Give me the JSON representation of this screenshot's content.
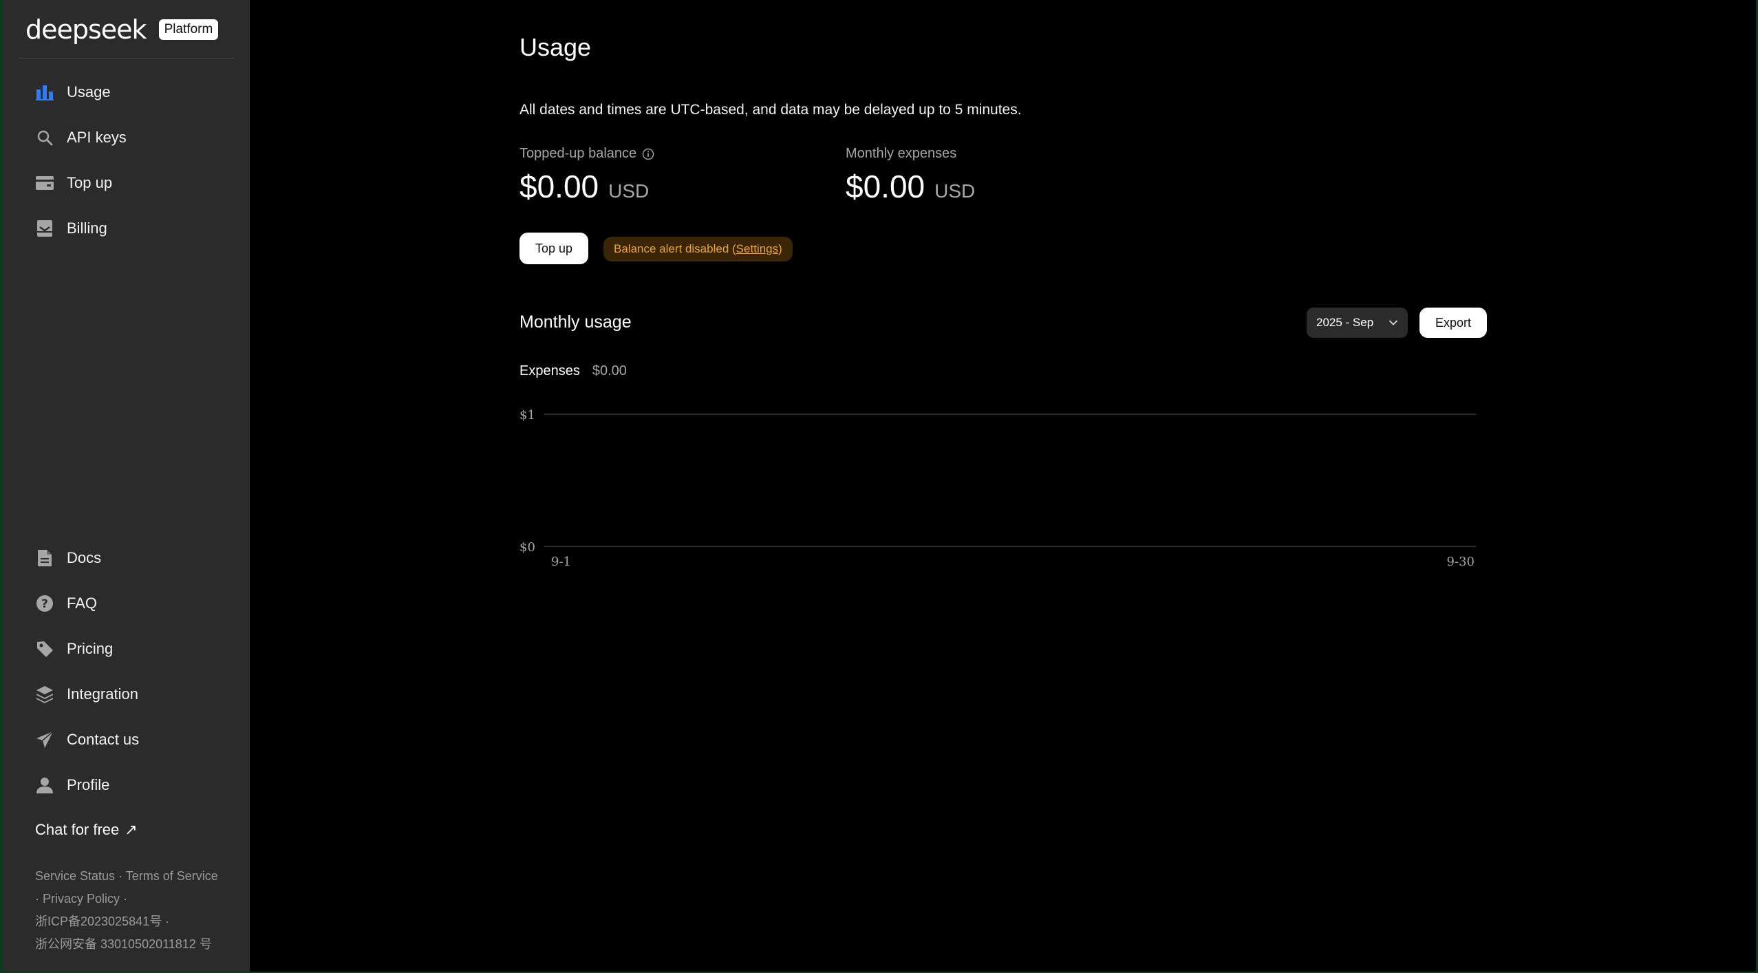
{
  "brand": {
    "logo_text": "deepseek",
    "badge": "Platform"
  },
  "sidebar": {
    "top_items": [
      {
        "label": "Usage",
        "icon": "bar-chart-icon",
        "active": true
      },
      {
        "label": "API keys",
        "icon": "search-icon"
      },
      {
        "label": "Top up",
        "icon": "wallet-icon"
      },
      {
        "label": "Billing",
        "icon": "invoice-icon"
      }
    ],
    "bottom_items": [
      {
        "label": "Docs",
        "icon": "document-icon"
      },
      {
        "label": "FAQ",
        "icon": "question-icon"
      },
      {
        "label": "Pricing",
        "icon": "tag-icon"
      },
      {
        "label": "Integration",
        "icon": "layers-icon"
      },
      {
        "label": "Contact us",
        "icon": "send-icon"
      },
      {
        "label": "Profile",
        "icon": "user-icon"
      }
    ],
    "chat_free": "Chat for free",
    "chat_free_arrow": "↗",
    "footer": {
      "service_status": "Service Status",
      "sep1": " · ",
      "terms": "Terms of Service",
      "sep2": " · ",
      "privacy": "Privacy Policy",
      "sep3": " ·",
      "icp": "浙ICP备2023025841号 ·",
      "police": "浙公网安备 33010502011812 号"
    },
    "accent_color": "#2f7cf6"
  },
  "main": {
    "title": "Usage",
    "notice": "All dates and times are UTC-based, and data may be delayed up to 5 minutes.",
    "balance": {
      "label": "Topped-up balance",
      "value": "$0.00",
      "unit": "USD"
    },
    "expenses": {
      "label": "Monthly expenses",
      "value": "$0.00",
      "unit": "USD"
    },
    "topup_button": "Top up",
    "alert": {
      "prefix": "Balance alert disabled (",
      "link": "Settings",
      "suffix": ")"
    },
    "monthly": {
      "title": "Monthly usage",
      "selected_month": "2025 - Sep",
      "export_button": "Export",
      "legend_name": "Expenses",
      "legend_value": "$0.00"
    }
  },
  "chart_data": {
    "type": "line",
    "y_ticks": [
      "$1",
      "$0"
    ],
    "ylim": [
      0,
      1
    ],
    "x_ticks": [
      "9-1",
      "9-30"
    ],
    "series": [
      {
        "name": "Expenses",
        "values": []
      }
    ],
    "grid": true
  }
}
